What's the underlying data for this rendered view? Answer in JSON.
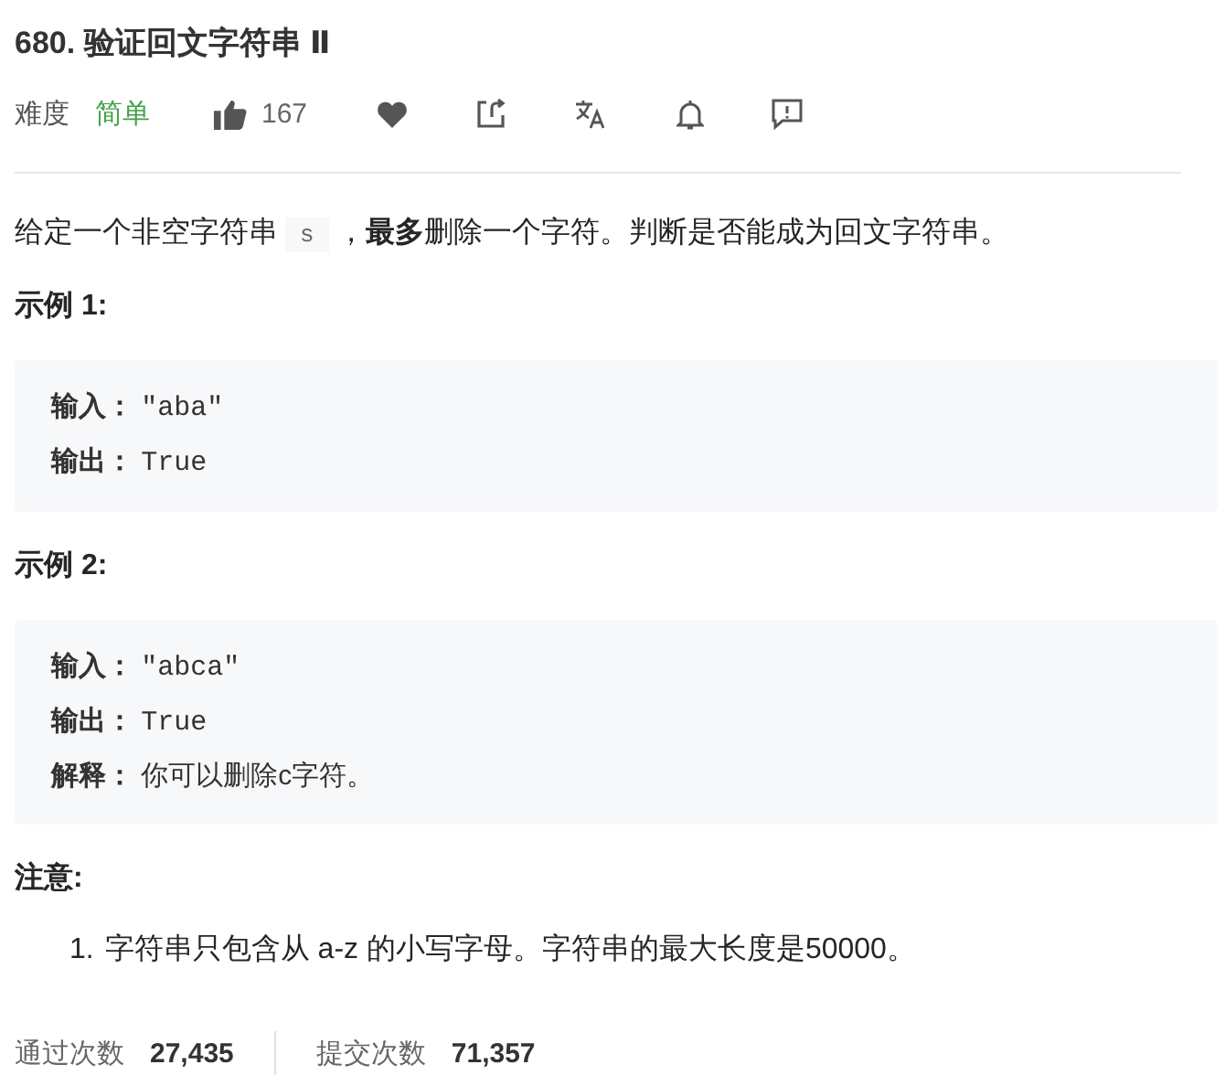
{
  "title": "680. 验证回文字符串 Ⅱ",
  "meta": {
    "difficulty_label": "难度",
    "difficulty": "简单",
    "likes": "167",
    "liked": false
  },
  "description": {
    "before": "给定一个非空字符串",
    "code": "s",
    "after": "，**最多**删除一个字符。判断是否能成为回文字符串。"
  },
  "examples": [
    {
      "title": "示例 1:",
      "lines": [
        {
          "label": "输入：",
          "value": "\"aba\"",
          "kind": "code"
        },
        {
          "label": "输出：",
          "value": "True",
          "kind": "code"
        }
      ]
    },
    {
      "title": "示例 2:",
      "lines": [
        {
          "label": "输入：",
          "value": "\"abca\"",
          "kind": "code"
        },
        {
          "label": "输出：",
          "value": "True",
          "kind": "code"
        },
        {
          "label": "解释：",
          "value": "你可以删除c字符。",
          "kind": "text"
        }
      ]
    }
  ],
  "notes": {
    "title": "注意:",
    "items": [
      {
        "number": "1.",
        "text": "字符串只包含从 a-z 的小写字母。字符串的最大长度是50000。"
      }
    ]
  },
  "stats": [
    {
      "label": "通过次数",
      "value": "27,435"
    },
    {
      "label": "提交次数",
      "value": "71,357"
    }
  ]
}
